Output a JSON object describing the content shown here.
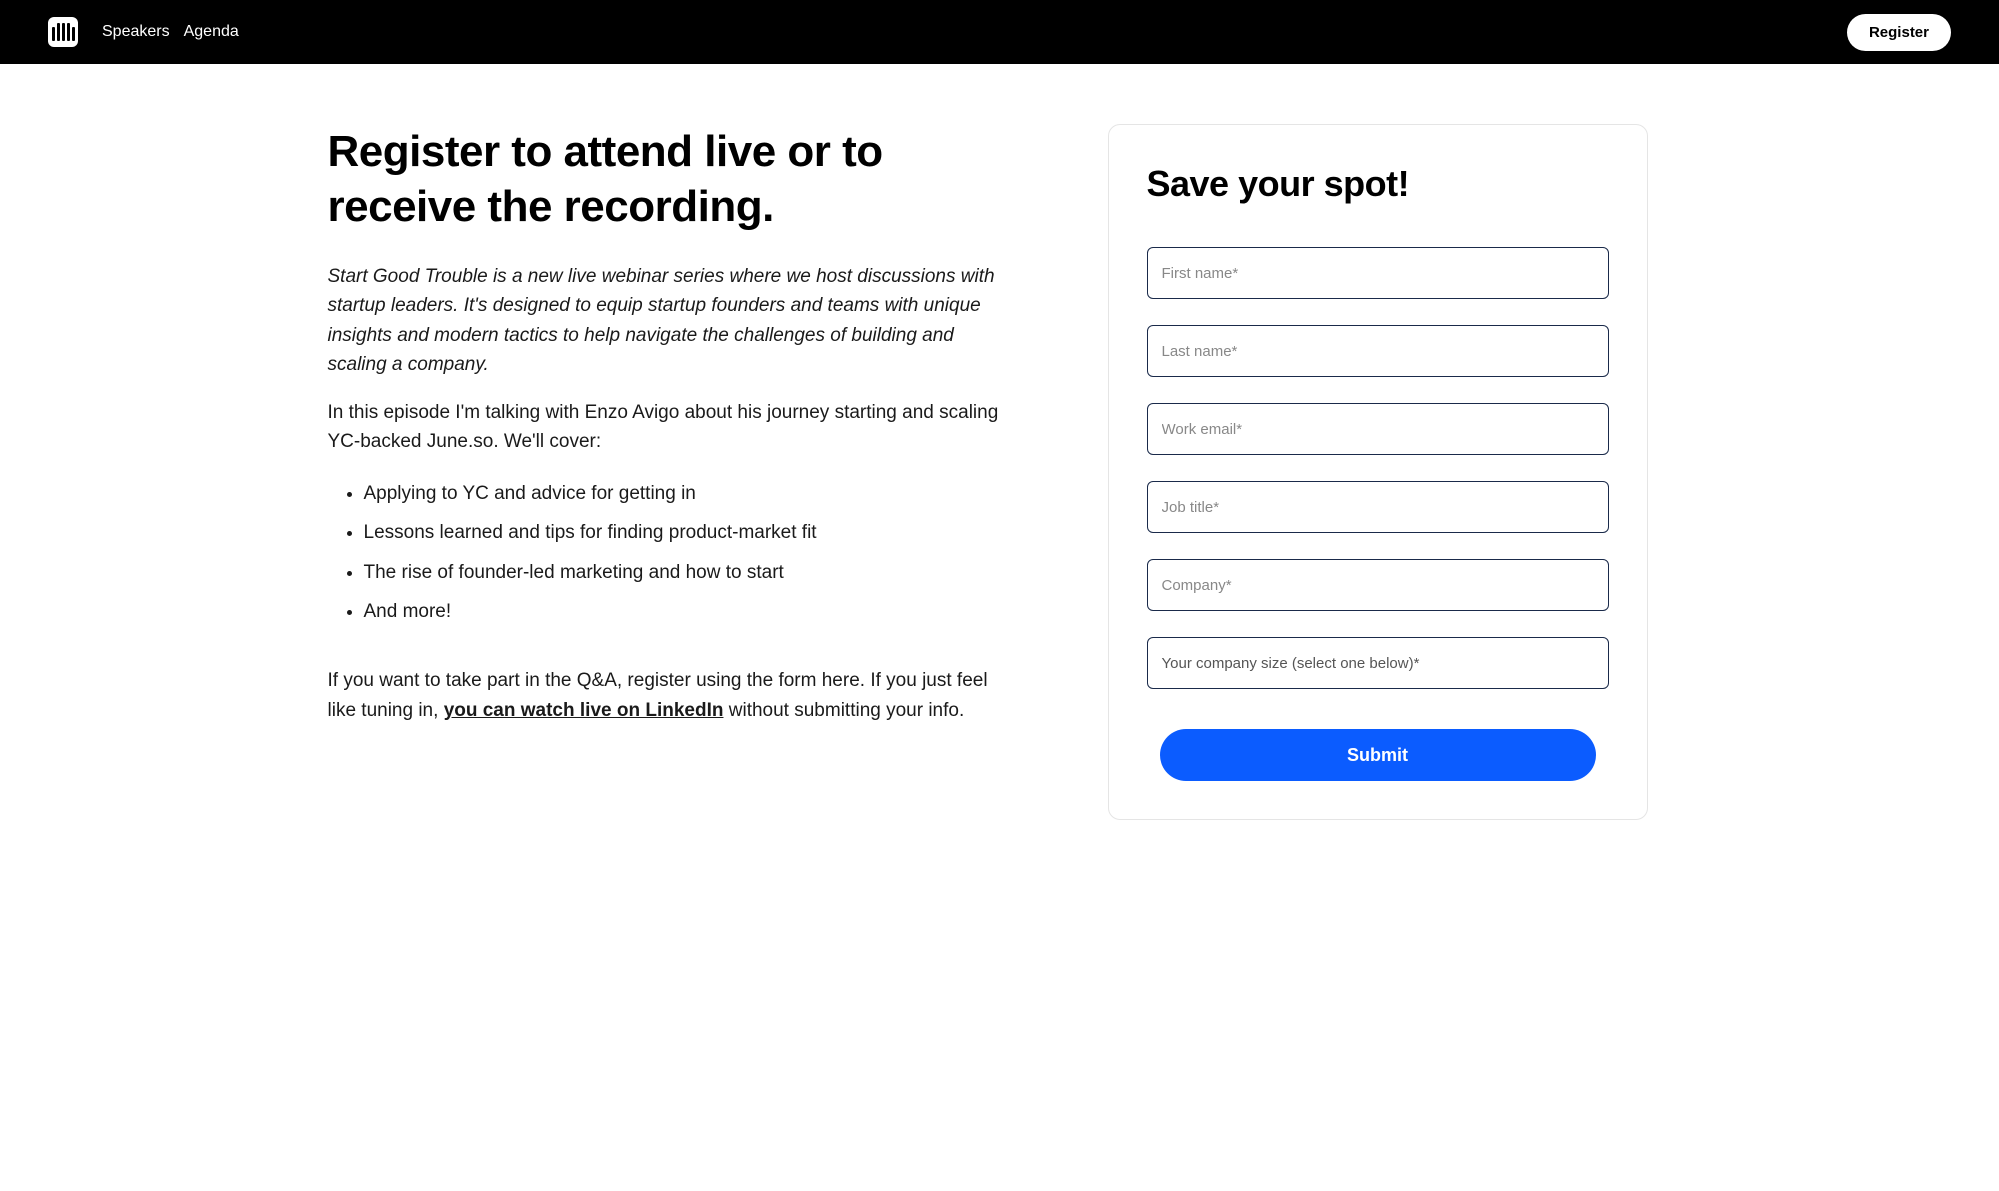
{
  "header": {
    "nav": [
      {
        "label": "Speakers"
      },
      {
        "label": "Agenda"
      }
    ],
    "register_label": "Register"
  },
  "content": {
    "title": "Register to attend live or to receive the recording.",
    "intro": "Start Good Trouble is a new live webinar series where we host discussions with startup leaders. It's designed to equip startup founders and teams with unique insights and modern tactics to help navigate the challenges of building and scaling a company.",
    "episode": "In this episode I'm talking with Enzo Avigo about his journey starting and scaling YC-backed June.so. We'll cover:",
    "bullets": [
      "Applying to YC and advice for getting in",
      "Lessons learned and tips for finding product-market fit",
      "The rise of founder-led marketing and how to start",
      "And more!"
    ],
    "cta_before": "If you want to take part in the Q&A, register using the form here. If you just feel like tuning in, ",
    "cta_link": "you can watch live on LinkedIn",
    "cta_after": " without submitting your info."
  },
  "form": {
    "title": "Save your spot!",
    "fields": {
      "first_name": {
        "placeholder": "First name*"
      },
      "last_name": {
        "placeholder": "Last name*"
      },
      "work_email": {
        "placeholder": "Work email*"
      },
      "job_title": {
        "placeholder": "Job title*"
      },
      "company": {
        "placeholder": "Company*"
      },
      "company_size": {
        "label": "Your company size (select one below)*"
      }
    },
    "submit_label": "Submit"
  }
}
